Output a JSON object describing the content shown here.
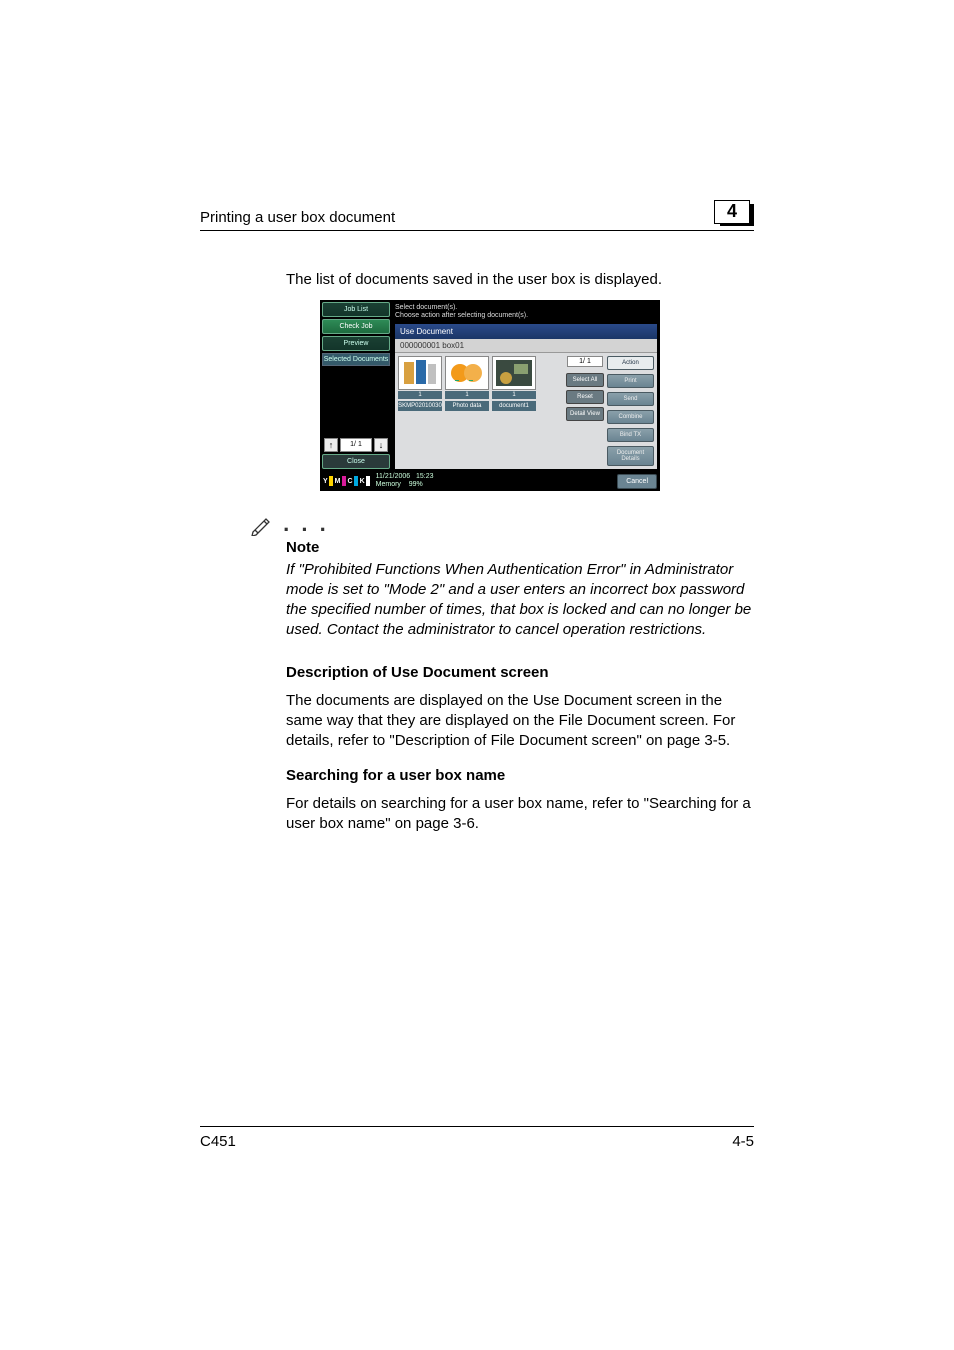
{
  "header": {
    "title": "Printing a user box document",
    "chapter_number": "4"
  },
  "intro": "The list of documents saved in the user box is displayed.",
  "device": {
    "left": {
      "job_list": "Job List",
      "check_job": "Check Job",
      "preview": "Preview",
      "selected_documents": "Selected Documents",
      "page_indicator": "1/ 1",
      "up": "↑",
      "down": "↓",
      "close": "Close"
    },
    "instructions_line1": "Select document(s).",
    "instructions_line2": "Choose action after selecting document(s).",
    "bluebar": "Use Document",
    "subbar": "000000001   box01",
    "thumbs": [
      {
        "badge": "1",
        "label": "SKMP02010030"
      },
      {
        "badge": "1",
        "label": "Photo data"
      },
      {
        "badge": "1",
        "label": "document1"
      }
    ],
    "right_page": "1/  1",
    "side": {
      "select_all": "Select All",
      "reset": "Reset",
      "detail_view": "Detail View"
    },
    "actions": {
      "header": "Action",
      "print": "Print",
      "send": "Send",
      "combine": "Combine",
      "bind_tx": "Bind TX",
      "doc_details": "Document Details"
    },
    "footer": {
      "date": "11/21/2006",
      "time": "15:23",
      "memory": "Memory",
      "memory_pct": "99%",
      "cancel": "Cancel",
      "toner": {
        "y": "Y",
        "m": "M",
        "c": "C",
        "k": "K"
      }
    }
  },
  "note": {
    "label": "Note",
    "body": "If \"Prohibited Functions When Authentication Error\" in Administrator mode is set to \"Mode 2\" and a user enters an incorrect box password the specified number of times, that box is locked and can no longer be used. Contact the administrator to cancel operation restrictions."
  },
  "sections": {
    "desc_heading": "Description of Use Document screen",
    "desc_body": "The documents are displayed on the Use Document screen in the same way that they are displayed on the File Document screen. For details, refer to \"Description of File Document screen\" on page 3-5.",
    "search_heading": "Searching for a user box name",
    "search_body": "For details on searching for a user box name, refer to \"Searching for a user box name\" on page 3-6."
  },
  "footer": {
    "model": "C451",
    "page": "4-5"
  }
}
